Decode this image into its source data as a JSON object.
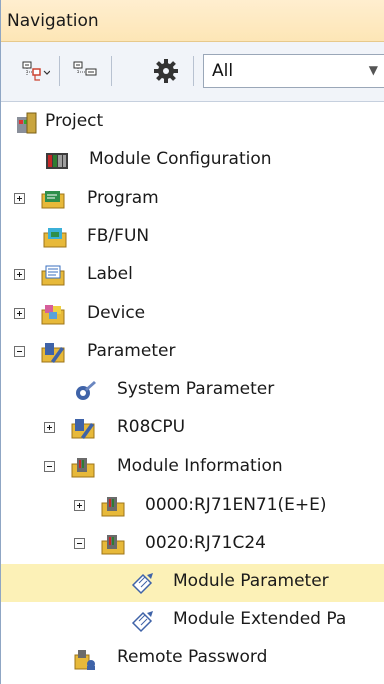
{
  "window": {
    "title": "Navigation"
  },
  "toolbar": {
    "filter_value": "All",
    "icons": [
      "expand-tree-icon",
      "collapse-tree-icon",
      "settings-gear-icon"
    ]
  },
  "tree": {
    "items": [
      {
        "label": "Project",
        "icon": "project-icon"
      },
      {
        "label": "Module Configuration",
        "icon": "module-configuration-icon"
      },
      {
        "label": "Program",
        "icon": "program-folder-icon"
      },
      {
        "label": "FB/FUN",
        "icon": "fb-fun-folder-icon"
      },
      {
        "label": "Label",
        "icon": "label-folder-icon"
      },
      {
        "label": "Device",
        "icon": "device-folder-icon"
      },
      {
        "label": "Parameter",
        "icon": "parameter-folder-icon"
      },
      {
        "label": "System Parameter",
        "icon": "system-parameter-icon"
      },
      {
        "label": "R08CPU",
        "icon": "cpu-parameter-icon"
      },
      {
        "label": "Module Information",
        "icon": "module-information-icon"
      },
      {
        "label": "0000:RJ71EN71(E+E)",
        "icon": "module-icon"
      },
      {
        "label": "0020:RJ71C24",
        "icon": "module-icon"
      },
      {
        "label": "Module Parameter",
        "icon": "module-parameter-icon"
      },
      {
        "label": "Module Extended Pa",
        "icon": "module-extended-parameter-icon"
      },
      {
        "label": "Remote Password",
        "icon": "remote-password-icon"
      }
    ]
  }
}
